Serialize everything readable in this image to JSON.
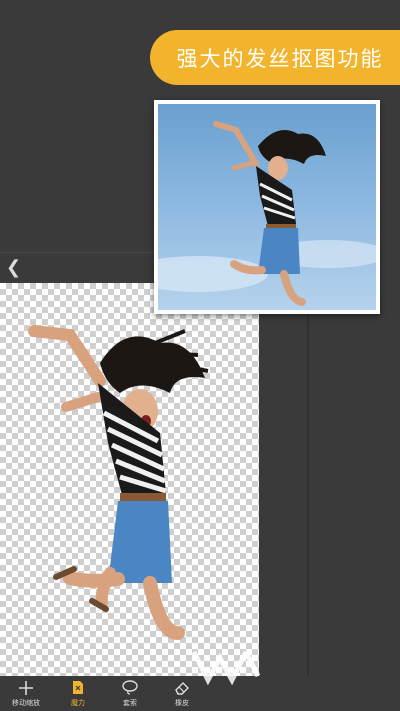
{
  "banner": {
    "text": "强大的发丝抠图功能"
  },
  "header": {
    "back_icon": "chevron-left-icon"
  },
  "toolbar": {
    "tools": [
      {
        "label": "移动缩放",
        "icon": "move-icon"
      },
      {
        "label": "魔力",
        "icon": "magic-icon",
        "active": true
      },
      {
        "label": "套索",
        "icon": "lasso-icon"
      },
      {
        "label": "橡皮",
        "icon": "eraser-icon"
      }
    ]
  },
  "colors": {
    "accent": "#f2b42c",
    "background": "#3a3a3a",
    "sky": "#8ab7e0"
  }
}
